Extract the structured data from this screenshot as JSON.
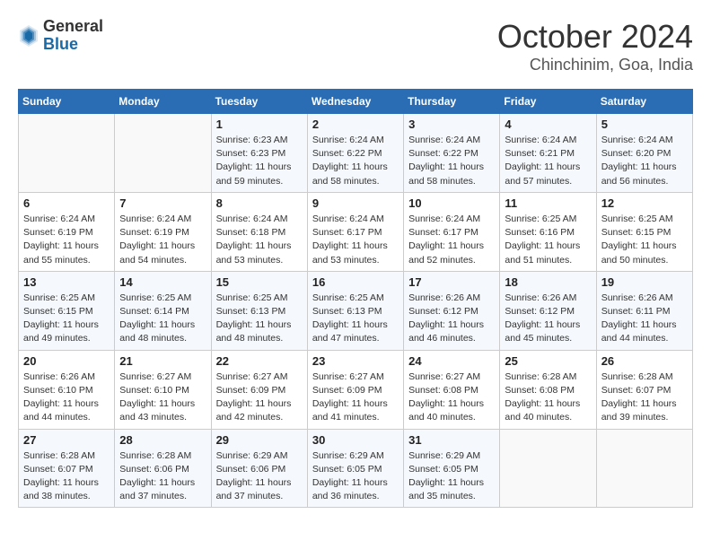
{
  "logo": {
    "general": "General",
    "blue": "Blue"
  },
  "title": "October 2024",
  "location": "Chinchinim, Goa, India",
  "days_header": [
    "Sunday",
    "Monday",
    "Tuesday",
    "Wednesday",
    "Thursday",
    "Friday",
    "Saturday"
  ],
  "weeks": [
    [
      {
        "day": "",
        "info": ""
      },
      {
        "day": "",
        "info": ""
      },
      {
        "day": "1",
        "info": "Sunrise: 6:23 AM\nSunset: 6:23 PM\nDaylight: 11 hours and 59 minutes."
      },
      {
        "day": "2",
        "info": "Sunrise: 6:24 AM\nSunset: 6:22 PM\nDaylight: 11 hours and 58 minutes."
      },
      {
        "day": "3",
        "info": "Sunrise: 6:24 AM\nSunset: 6:22 PM\nDaylight: 11 hours and 58 minutes."
      },
      {
        "day": "4",
        "info": "Sunrise: 6:24 AM\nSunset: 6:21 PM\nDaylight: 11 hours and 57 minutes."
      },
      {
        "day": "5",
        "info": "Sunrise: 6:24 AM\nSunset: 6:20 PM\nDaylight: 11 hours and 56 minutes."
      }
    ],
    [
      {
        "day": "6",
        "info": "Sunrise: 6:24 AM\nSunset: 6:19 PM\nDaylight: 11 hours and 55 minutes."
      },
      {
        "day": "7",
        "info": "Sunrise: 6:24 AM\nSunset: 6:19 PM\nDaylight: 11 hours and 54 minutes."
      },
      {
        "day": "8",
        "info": "Sunrise: 6:24 AM\nSunset: 6:18 PM\nDaylight: 11 hours and 53 minutes."
      },
      {
        "day": "9",
        "info": "Sunrise: 6:24 AM\nSunset: 6:17 PM\nDaylight: 11 hours and 53 minutes."
      },
      {
        "day": "10",
        "info": "Sunrise: 6:24 AM\nSunset: 6:17 PM\nDaylight: 11 hours and 52 minutes."
      },
      {
        "day": "11",
        "info": "Sunrise: 6:25 AM\nSunset: 6:16 PM\nDaylight: 11 hours and 51 minutes."
      },
      {
        "day": "12",
        "info": "Sunrise: 6:25 AM\nSunset: 6:15 PM\nDaylight: 11 hours and 50 minutes."
      }
    ],
    [
      {
        "day": "13",
        "info": "Sunrise: 6:25 AM\nSunset: 6:15 PM\nDaylight: 11 hours and 49 minutes."
      },
      {
        "day": "14",
        "info": "Sunrise: 6:25 AM\nSunset: 6:14 PM\nDaylight: 11 hours and 48 minutes."
      },
      {
        "day": "15",
        "info": "Sunrise: 6:25 AM\nSunset: 6:13 PM\nDaylight: 11 hours and 48 minutes."
      },
      {
        "day": "16",
        "info": "Sunrise: 6:25 AM\nSunset: 6:13 PM\nDaylight: 11 hours and 47 minutes."
      },
      {
        "day": "17",
        "info": "Sunrise: 6:26 AM\nSunset: 6:12 PM\nDaylight: 11 hours and 46 minutes."
      },
      {
        "day": "18",
        "info": "Sunrise: 6:26 AM\nSunset: 6:12 PM\nDaylight: 11 hours and 45 minutes."
      },
      {
        "day": "19",
        "info": "Sunrise: 6:26 AM\nSunset: 6:11 PM\nDaylight: 11 hours and 44 minutes."
      }
    ],
    [
      {
        "day": "20",
        "info": "Sunrise: 6:26 AM\nSunset: 6:10 PM\nDaylight: 11 hours and 44 minutes."
      },
      {
        "day": "21",
        "info": "Sunrise: 6:27 AM\nSunset: 6:10 PM\nDaylight: 11 hours and 43 minutes."
      },
      {
        "day": "22",
        "info": "Sunrise: 6:27 AM\nSunset: 6:09 PM\nDaylight: 11 hours and 42 minutes."
      },
      {
        "day": "23",
        "info": "Sunrise: 6:27 AM\nSunset: 6:09 PM\nDaylight: 11 hours and 41 minutes."
      },
      {
        "day": "24",
        "info": "Sunrise: 6:27 AM\nSunset: 6:08 PM\nDaylight: 11 hours and 40 minutes."
      },
      {
        "day": "25",
        "info": "Sunrise: 6:28 AM\nSunset: 6:08 PM\nDaylight: 11 hours and 40 minutes."
      },
      {
        "day": "26",
        "info": "Sunrise: 6:28 AM\nSunset: 6:07 PM\nDaylight: 11 hours and 39 minutes."
      }
    ],
    [
      {
        "day": "27",
        "info": "Sunrise: 6:28 AM\nSunset: 6:07 PM\nDaylight: 11 hours and 38 minutes."
      },
      {
        "day": "28",
        "info": "Sunrise: 6:28 AM\nSunset: 6:06 PM\nDaylight: 11 hours and 37 minutes."
      },
      {
        "day": "29",
        "info": "Sunrise: 6:29 AM\nSunset: 6:06 PM\nDaylight: 11 hours and 37 minutes."
      },
      {
        "day": "30",
        "info": "Sunrise: 6:29 AM\nSunset: 6:05 PM\nDaylight: 11 hours and 36 minutes."
      },
      {
        "day": "31",
        "info": "Sunrise: 6:29 AM\nSunset: 6:05 PM\nDaylight: 11 hours and 35 minutes."
      },
      {
        "day": "",
        "info": ""
      },
      {
        "day": "",
        "info": ""
      }
    ]
  ]
}
